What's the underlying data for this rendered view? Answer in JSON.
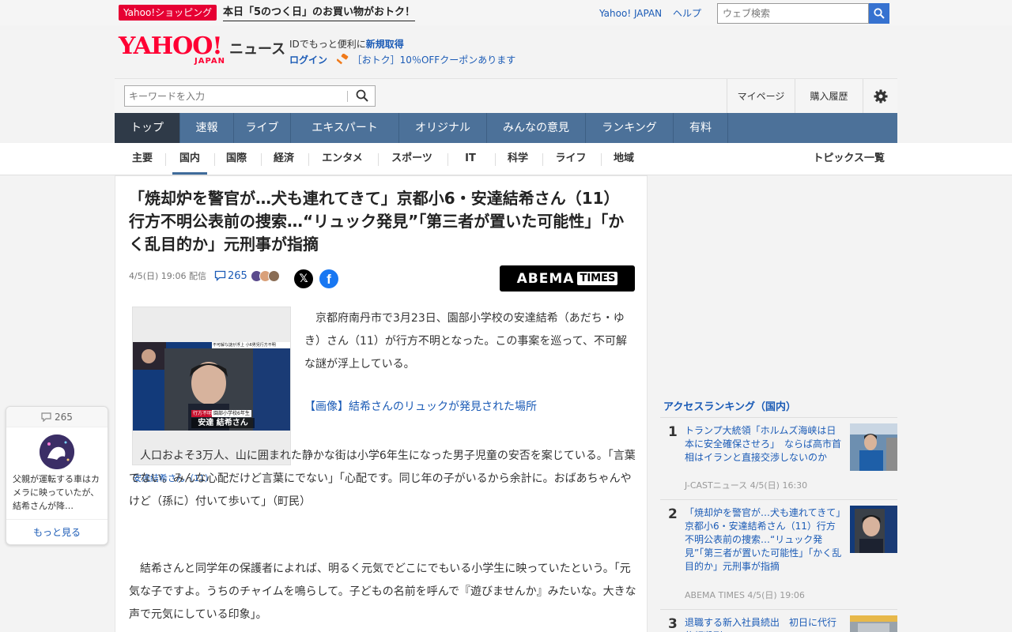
{
  "header": {
    "promo_badge": "Yahoo!ショッピング",
    "promo_text": "本日「5のつく日」のお買い物がおトク！",
    "util_links": [
      "Yahoo! JAPAN",
      "ヘルプ"
    ],
    "web_search_placeholder": "ウェブ検索",
    "logo_word": "YAHOO!",
    "logo_sub": "JAPAN",
    "news_label": "ニュース",
    "id_line_prefix": "IDでもっと便利に",
    "id_line_link": "新規取得",
    "login_label": "ログイン",
    "coupon_text": "［おトク］10％OFFクーポンあります"
  },
  "search": {
    "keyword_placeholder": "キーワードを入力",
    "mypage_label": "マイページ",
    "history_label": "購入履歴"
  },
  "category_tabs": [
    {
      "label": "トップ",
      "active": true
    },
    {
      "label": "速報"
    },
    {
      "label": "ライブ"
    },
    {
      "label": "エキスパート"
    },
    {
      "label": "オリジナル"
    },
    {
      "label": "みんなの意見"
    },
    {
      "label": "ランキング"
    },
    {
      "label": "有料"
    }
  ],
  "sub_tabs": [
    {
      "label": "主要"
    },
    {
      "label": "国内",
      "active": true
    },
    {
      "label": "国際"
    },
    {
      "label": "経済"
    },
    {
      "label": "エンタメ"
    },
    {
      "label": "スポーツ"
    },
    {
      "label": "IT"
    },
    {
      "label": "科学"
    },
    {
      "label": "ライフ"
    },
    {
      "label": "地域"
    }
  ],
  "topics_all_label": "トピックス一覧",
  "article": {
    "title": "「焼却炉を警官が…犬も連れてきて」京都小6・安達結希さん（11）行方不明公表前の捜索…“リュック発見”「第三者が置いた可能性」「かく乱目的か」元刑事が指摘",
    "date": "4/5(日) 19:06 配信",
    "comment_count": "265",
    "share_x": "𝕏",
    "share_fb": "f",
    "publisher_word": "ABEMA",
    "publisher_badge": "TIMES",
    "photo_caption": "安達結希さん（11）",
    "photo_overlay_title": "不可解な謎が浮上 小6男児行方不明",
    "photo_overlay_name": "安達 結希さん",
    "photo_overlay_tag": "行方不明",
    "photo_overlay_grade": "園部小学校6年生",
    "paragraph1": "京都府南丹市で3月23日、園部小学校の安達結希（あだち・ゆき）さん（11）が行方不明となった。この事案を巡って、不可解な謎が浮上している。",
    "image_link": "【画像】結希さんのリュックが発見された場所",
    "paragraph2": "人口およそ3万人、山に囲まれた静かな街は小学6年生になった男子児童の安否を案じている。「言葉でない。みんな心配だけど言葉にでない」「心配です。同じ年の子がいるから余計に。おばあちゃんやけど（孫に）付いて歩いて」（町民）",
    "paragraph3": "結希さんと同学年の保護者によれば、明るく元気でどこにでもいる小学生に映っていたという。「元気な子ですよ。うちのチャイムを鳴らして。子どもの名前を呼んで『遊びませんか』みたいな。大きな声で元気にしている印象」。"
  },
  "floating_comment": {
    "count": "265",
    "text": "父親が運転する車はカメラに映っていたが、結希さんが降…",
    "more_label": "もっと見る"
  },
  "ranking": {
    "title": "アクセスランキング（国内）",
    "items": [
      {
        "rank": "1",
        "title": "トランプ大統領「ホルムズ海峡は日本に安全確保させろ」　ならば高市首相はイランと直接交渉しないのか",
        "source": "J-CASTニュース 4/5(日) 16:30"
      },
      {
        "rank": "2",
        "title": "「焼却炉を警官が…犬も連れてきて」京都小6・安達結希さん（11）行方不明公表前の捜索…“リュック発見”「第三者が置いた可能性」「かく乱目的か」元刑事が指摘",
        "source": "ABEMA TIMES 4/5(日) 19:06"
      },
      {
        "rank": "3",
        "title": "退職する新入社員続出　初日に代行依頼殺到…",
        "source": ""
      }
    ]
  },
  "colors": {
    "accent_red": "#ff0033",
    "nav_blue": "#4c7199",
    "nav_active": "#2f3a48",
    "link_blue": "#1b5bb6"
  }
}
